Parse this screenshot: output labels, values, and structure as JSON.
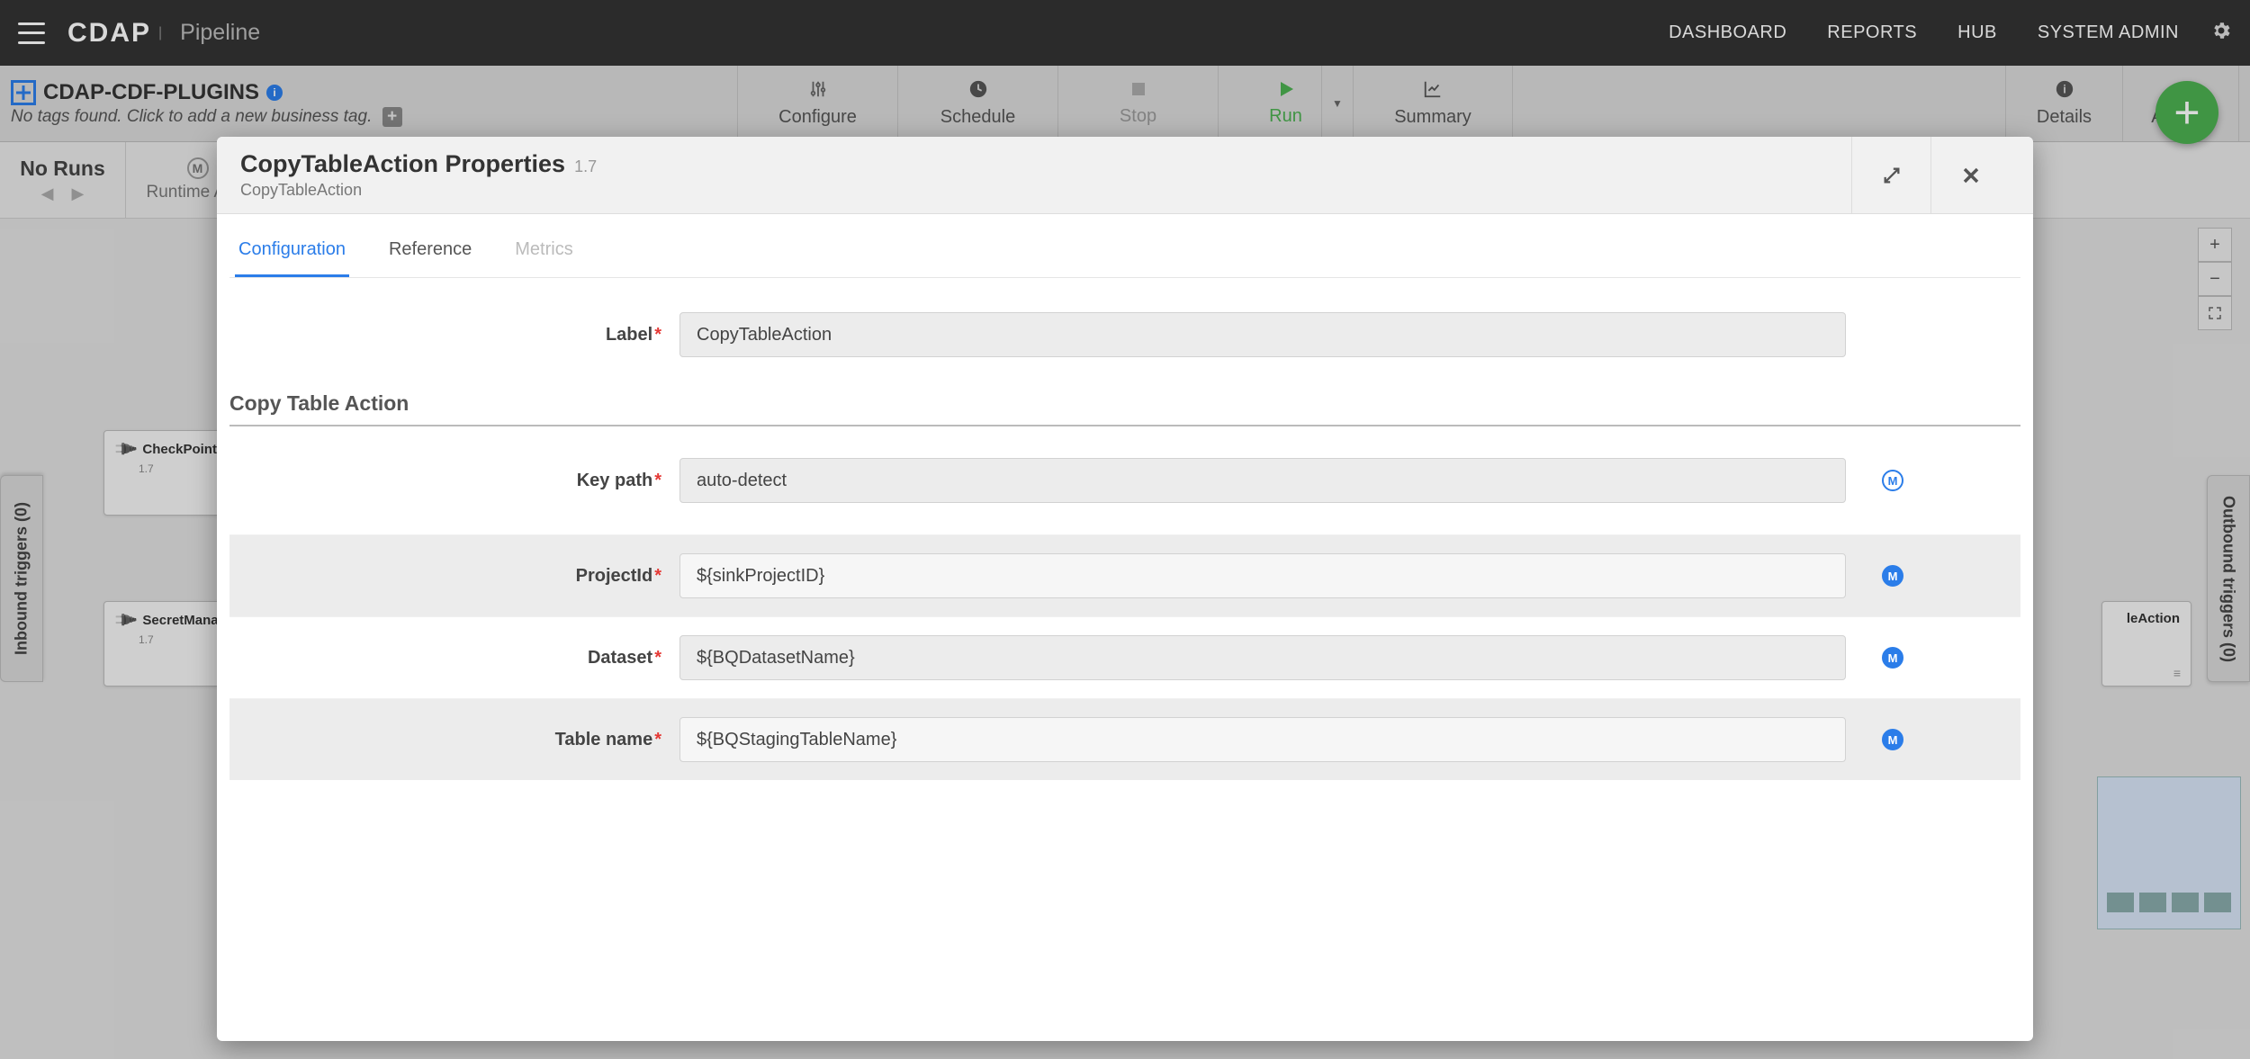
{
  "topnav": {
    "logo": "CDAP",
    "product": "Pipeline",
    "links": {
      "dashboard": "DASHBOARD",
      "reports": "REPORTS",
      "hub": "HUB",
      "system_admin": "SYSTEM ADMIN"
    }
  },
  "pipeline": {
    "name": "CDAP-CDF-PLUGINS",
    "tags_hint": "No tags found. Click to add a new business tag.",
    "toolbar": {
      "configure": "Configure",
      "schedule": "Schedule",
      "stop": "Stop",
      "run": "Run",
      "summary": "Summary",
      "details": "Details",
      "actions": "Actions"
    },
    "runs": {
      "label": "No Runs",
      "runtime_args": "Runtime Args"
    }
  },
  "canvas": {
    "nodes": [
      {
        "title": "CheckPointReadA...",
        "version": "1.7"
      },
      {
        "title": "SecretManagerAc...",
        "version": "1.7"
      }
    ],
    "other_node": "leAction"
  },
  "triggers": {
    "inbound": "Inbound triggers (0)",
    "outbound": "Outbound triggers (0)"
  },
  "modal": {
    "title": "CopyTableAction Properties",
    "version": "1.7",
    "subtitle": "CopyTableAction",
    "tabs": {
      "configuration": "Configuration",
      "reference": "Reference",
      "metrics": "Metrics"
    },
    "section_heading": "Copy Table Action",
    "fields": {
      "label": {
        "label": "Label",
        "value": "CopyTableAction"
      },
      "key_path": {
        "label": "Key path",
        "value": "auto-detect"
      },
      "project_id": {
        "label": "ProjectId",
        "value": "${sinkProjectID}"
      },
      "dataset": {
        "label": "Dataset",
        "value": "${BQDatasetName}"
      },
      "table_name": {
        "label": "Table name",
        "value": "${BQStagingTableName}"
      }
    }
  }
}
